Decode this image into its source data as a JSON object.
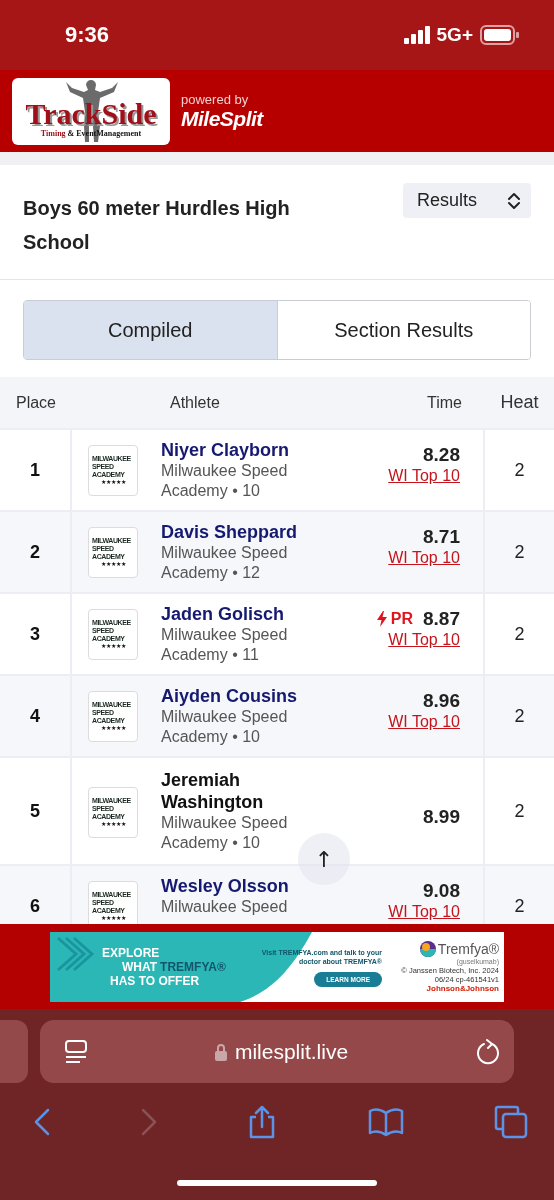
{
  "status_bar": {
    "time": "9:36",
    "network": "5G+"
  },
  "header": {
    "logo_title": "TrackSide",
    "logo_timing": "Timing",
    "logo_rest": "& EventManagement",
    "powered_by": "powered by",
    "brand": "MileSplit"
  },
  "event": {
    "title": "Boys 60 meter Hurdles High School",
    "view_select": "Results"
  },
  "tabs": [
    {
      "label": "Compiled",
      "selected": true
    },
    {
      "label": "Section Results",
      "selected": false
    }
  ],
  "table": {
    "columns": [
      "Place",
      "Athlete",
      "Time",
      "Heat"
    ],
    "rows": [
      {
        "place": "1",
        "name": "Niyer Clayborn",
        "linked": true,
        "school": "Milwaukee Speed Academy • 10",
        "logo": "MILWAUKEE SPEED ACADEMY",
        "logo_stars": "★★★★★",
        "time": "8.28",
        "badge": "WI Top 10",
        "heat": "2"
      },
      {
        "place": "2",
        "name": "Davis Sheppard",
        "linked": true,
        "school": "Milwaukee Speed Academy • 12",
        "logo": "MILWAUKEE SPEED ACADEMY",
        "logo_stars": "★★★★★",
        "time": "8.71",
        "badge": "WI Top 10",
        "heat": "2"
      },
      {
        "place": "3",
        "name": "Jaden Golisch",
        "linked": true,
        "school": "Milwaukee Speed Academy • 11",
        "logo": "MILWAUKEE SPEED ACADEMY",
        "logo_stars": "★★★★★",
        "pr": "PR",
        "time": "8.87",
        "badge": "WI Top 10",
        "heat": "2"
      },
      {
        "place": "4",
        "name": "Aiyden Cousins",
        "linked": true,
        "school": "Milwaukee Speed Academy • 10",
        "logo": "MILWAUKEE SPEED ACADEMY",
        "logo_stars": "★★★★★",
        "time": "8.96",
        "badge": "WI Top 10",
        "heat": "2"
      },
      {
        "place": "5",
        "name": "Jeremiah Washington",
        "linked": false,
        "school": "Milwaukee Speed Academy • 10",
        "logo": "MILWAUKEE SPEED ACADEMY",
        "logo_stars": "★★★★★",
        "time": "8.99",
        "heat": "2"
      },
      {
        "place": "6",
        "name": "Wesley Olsson",
        "linked": true,
        "school": "Milwaukee Speed",
        "logo": "MILWAUKEE SPEED ACADEMY",
        "logo_stars": "★★★★★",
        "time": "9.08",
        "badge": "WI Top 10",
        "heat": "2"
      }
    ]
  },
  "scroll_top": {
    "label": "↑"
  },
  "ad": {
    "headline_1": "EXPLORE",
    "headline_2": "WHAT",
    "headline_brand": "TREMFYA®",
    "headline_3": "HAS TO OFFER",
    "body": "Visit **TREMFYA**.com and talk to your doctor about **TREMFYA**®",
    "button": "LEARN MORE",
    "brand": "Tremfya®",
    "generic": "(guselkumab)",
    "legal_1": "© Janssen Biotech, Inc. 2024",
    "legal_2": "06/24  cp-461541v1",
    "company": "Johnson&Johnson"
  },
  "browser": {
    "url": "milesplit.live"
  }
}
